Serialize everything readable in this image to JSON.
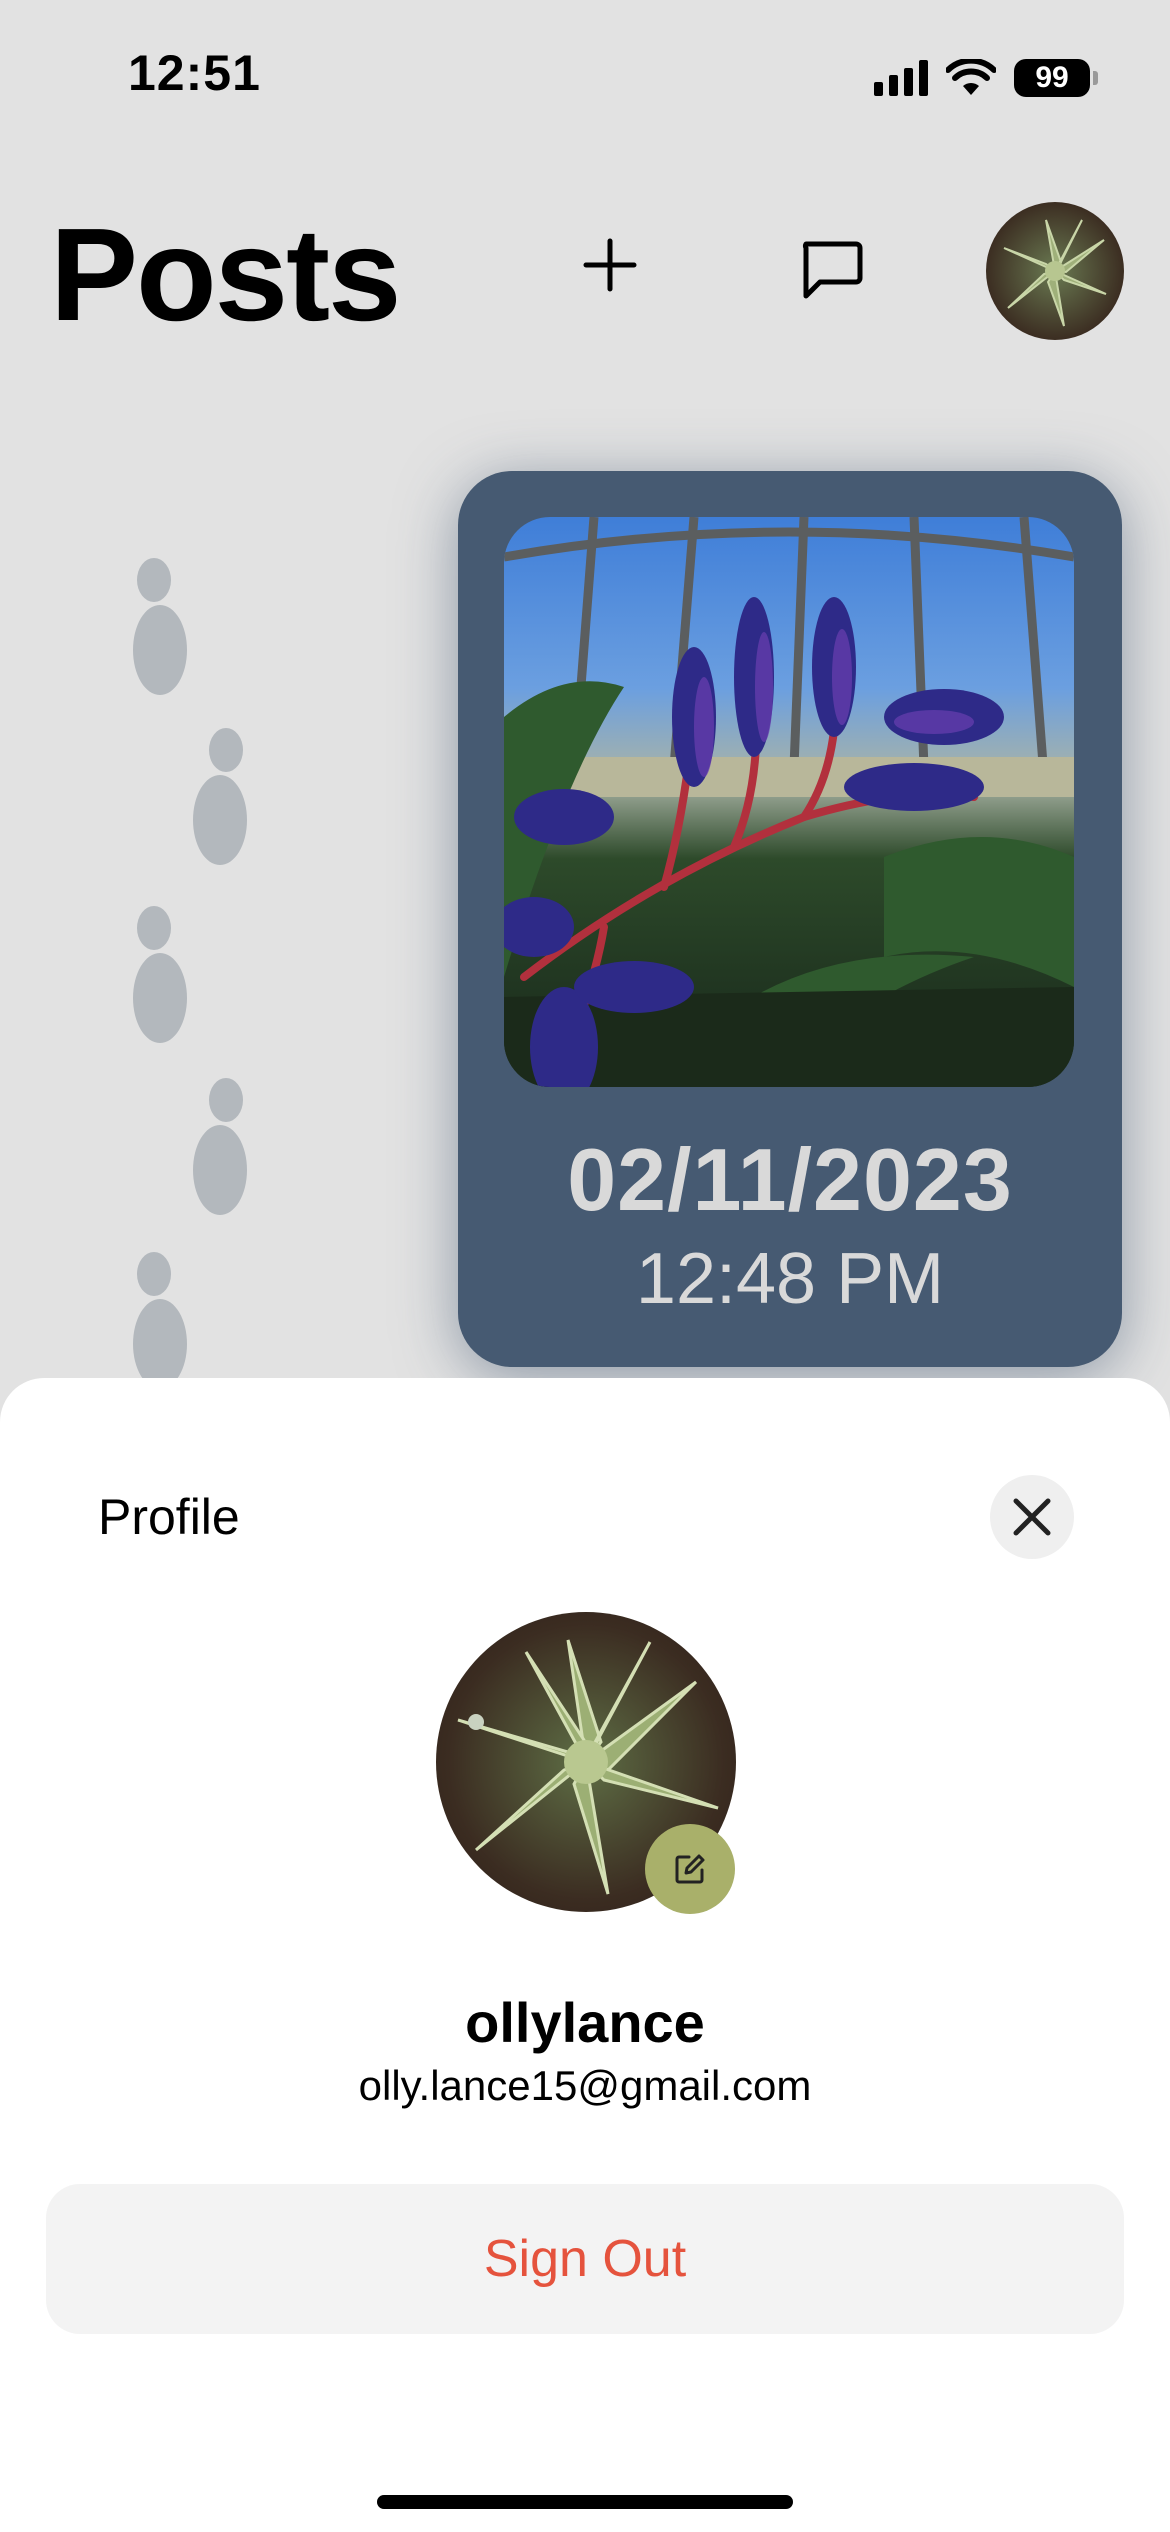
{
  "status_bar": {
    "time": "12:51",
    "battery": "99",
    "icons": [
      "cellular-signal-icon",
      "wifi-icon",
      "battery-icon"
    ]
  },
  "header": {
    "title": "Posts",
    "icons": [
      "plus-icon",
      "chat-bubble-icon"
    ]
  },
  "feed": {
    "posts": [
      {
        "date": "02/11/2023",
        "time": "12:48 PM"
      }
    ]
  },
  "profile_sheet": {
    "title": "Profile",
    "username": "ollylance",
    "email": "olly.lance15@gmail.com",
    "sign_out_label": "Sign Out"
  },
  "colors": {
    "background": "#e2e2e2",
    "card": "#465a72",
    "card_text": "#d9d9d9",
    "sign_out_text": "#e5533d",
    "edit_badge": "#a9b06a",
    "footprint": "#b3b8bd"
  }
}
